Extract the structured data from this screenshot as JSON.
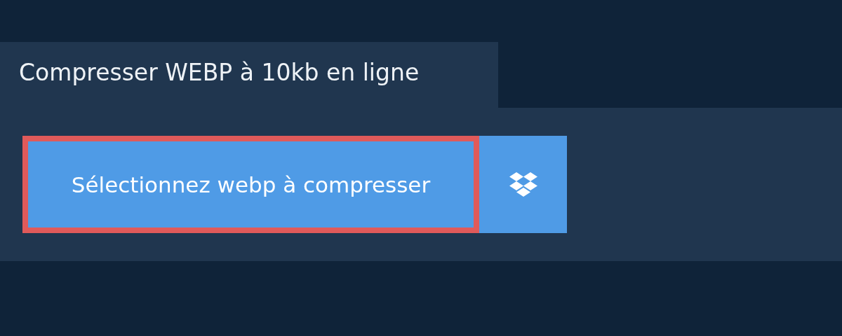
{
  "tab": {
    "title": "Compresser WEBP à 10kb en ligne"
  },
  "buttons": [
    {
      "kind": "select",
      "label": "Sélectionnez webp à compresser",
      "focused": true
    },
    {
      "kind": "cloud"
    }
  ]
}
